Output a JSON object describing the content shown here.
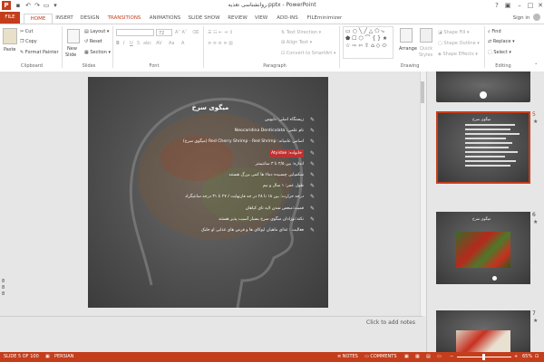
{
  "app": {
    "title": "روانشناسی تغذیه.pptx - PowerPoint",
    "accent": "#c43e1c",
    "sign_in": "Sign in"
  },
  "tabs": [
    "FILE",
    "HOME",
    "INSERT",
    "DESIGN",
    "TRANSITIONS",
    "ANIMATIONS",
    "SLIDE SHOW",
    "REVIEW",
    "VIEW",
    "ADD-INS",
    "FILEminimizer"
  ],
  "ribbon": {
    "clipboard": {
      "paste": "Paste",
      "cut": "Cut",
      "copy": "Copy",
      "format_painter": "Format Painter",
      "label": "Clipboard"
    },
    "slides": {
      "new_slide": "New",
      "new_slide2": "Slide",
      "layout": "Layout",
      "reset": "Reset",
      "section": "Section",
      "label": "Slides"
    },
    "font": {
      "font_name": "",
      "font_size": "72",
      "label": "Font",
      "bold": "B",
      "italic": "I",
      "underline": "U",
      "strike": "S",
      "shadow": "abc",
      "spacing": "AV",
      "case": "Aa",
      "color": "A"
    },
    "paragraph": {
      "text_direction": "Text Direction",
      "align_text": "Align Text",
      "smartart": "Convert to SmartArt",
      "label": "Paragraph"
    },
    "drawing": {
      "arrange": "Arrange",
      "quick_styles": "Quick",
      "quick_styles2": "Styles",
      "shape_fill": "Shape Fill",
      "shape_outline": "Shape Outline",
      "shape_effects": "Shape Effects",
      "label": "Drawing"
    },
    "editing": {
      "find": "Find",
      "replace": "Replace",
      "select": "Select",
      "label": "Editing"
    }
  },
  "slide": {
    "title": "میگوی سرخ",
    "bullets": [
      {
        "text": "زیستگاه اصلی: دایوس",
        "red": false
      },
      {
        "text": "نام علمی: Neocaridina Denticulata",
        "red": false
      },
      {
        "text": "اسامی عامیانه: Red Cherry Shrimp - Red Shrimp (میگوی سرخ)",
        "red": false
      },
      {
        "text": "خانواده: Atyidae",
        "red": true
      },
      {
        "text": "اندازه: بین ۲/۵ تا ۳ سانتیمتر",
        "red": false
      },
      {
        "text": "شکمپایی چسبیده دماء ها کمی بزرگ هستند",
        "red": false
      },
      {
        "text": "طول عمر: ۱ سال و نیم",
        "red": false
      },
      {
        "text": "درجه حرارت: بین ۱۸ تا ۲۸ در جه فارنهایت / ۲۷ تا ۳۱ درجه سانتیگراد",
        "red": false
      },
      {
        "text": "قمیت:مبعض شدن لاپه تای کیاهان",
        "red": false
      },
      {
        "text": "نکته:نوزادان میگوی سرخ بسیار آسیب پذیر هستند",
        "red": false
      },
      {
        "text": "فعالیت : غذای ماهیان ایوکای ها و قرص های غذایی او جلبک",
        "red": false
      }
    ]
  },
  "notes_placeholder": "Click to add notes",
  "left_numbers": [
    "8",
    "8",
    "8"
  ],
  "thumbnails": [
    {
      "num": "",
      "title": ""
    },
    {
      "num": "5",
      "title": "میگوی سرخ",
      "active": true
    },
    {
      "num": "6",
      "title": "میگوی سرخ",
      "active": false
    },
    {
      "num": "7",
      "title": "",
      "active": false
    }
  ],
  "status": {
    "slide": "SLIDE 5 OF 100",
    "language": "PERSIAN",
    "notes": "NOTES",
    "comments": "COMMENTS",
    "zoom": "65%"
  }
}
